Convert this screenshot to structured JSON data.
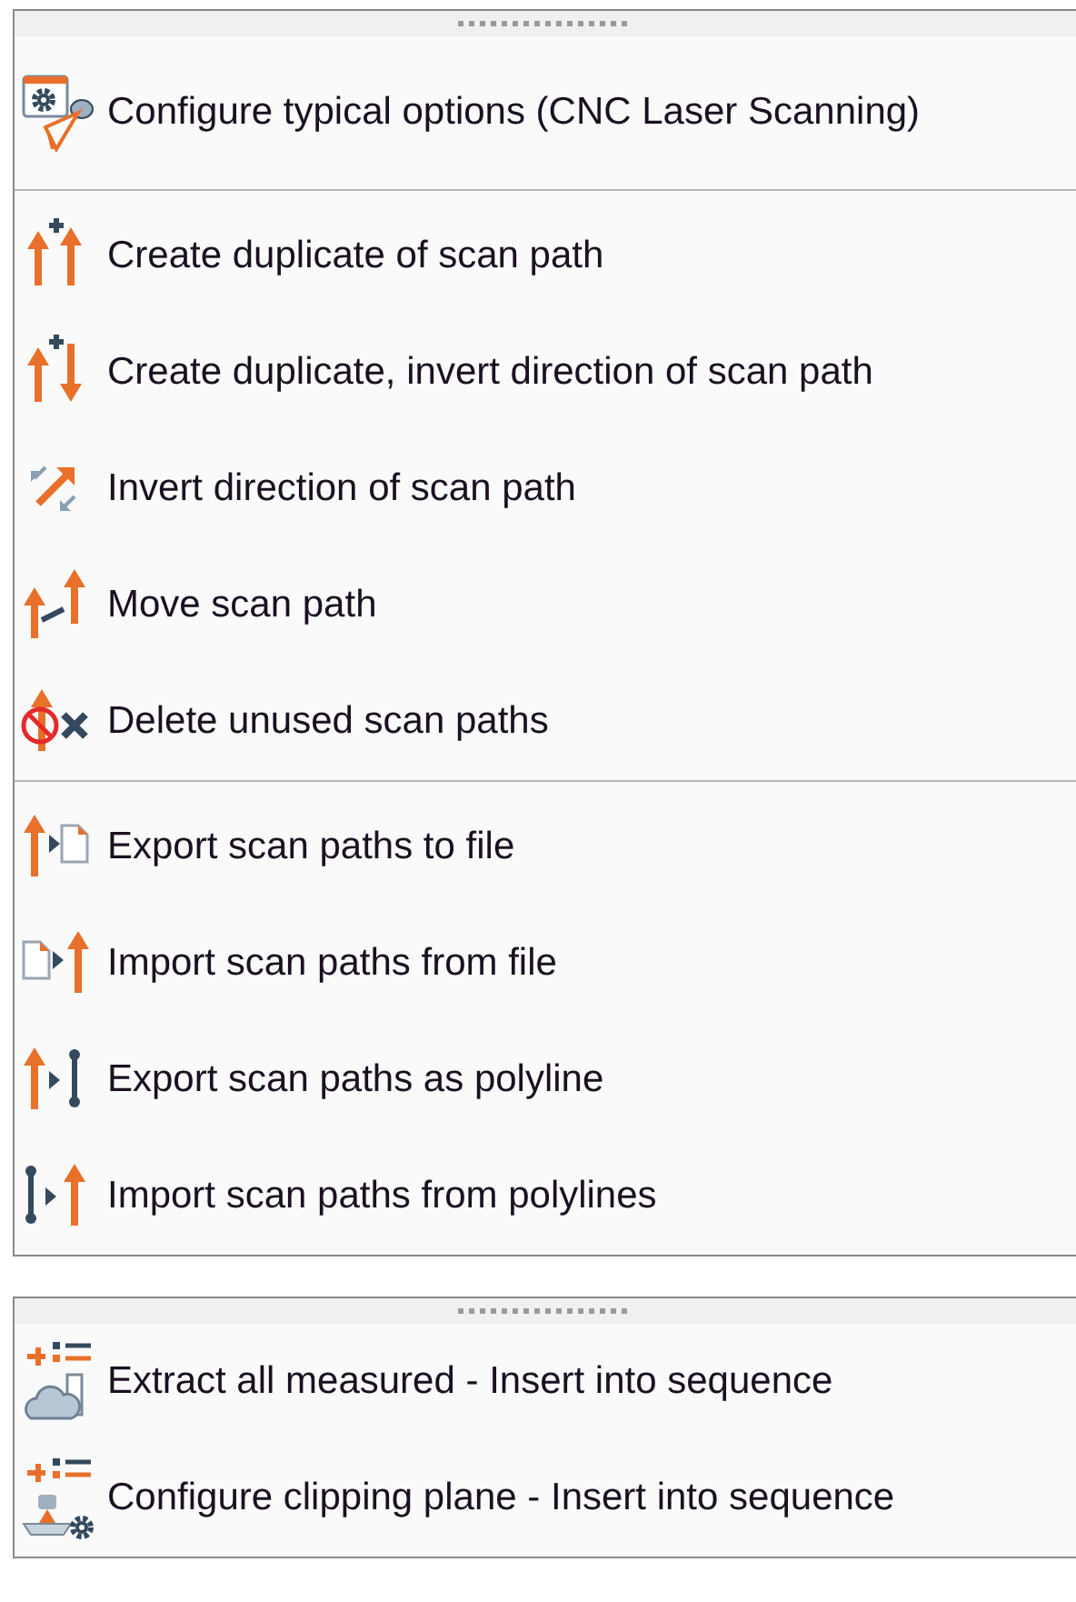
{
  "panels": [
    {
      "groups": [
        {
          "items": [
            {
              "label": "Configure typical options (CNC Laser Scanning)"
            }
          ]
        },
        {
          "items": [
            {
              "label": "Create duplicate of scan path"
            },
            {
              "label": "Create duplicate, invert direction of scan path"
            },
            {
              "label": "Invert direction of scan path"
            },
            {
              "label": "Move scan path"
            },
            {
              "label": "Delete unused scan paths"
            }
          ]
        },
        {
          "items": [
            {
              "label": "Export scan paths to file"
            },
            {
              "label": "Import scan paths from file"
            },
            {
              "label": "Export scan paths as polyline"
            },
            {
              "label": "Import scan paths from polylines"
            }
          ]
        }
      ]
    },
    {
      "groups": [
        {
          "items": [
            {
              "label": "Extract all measured - Insert into sequence"
            },
            {
              "label": "Configure clipping plane - Insert into sequence"
            }
          ]
        }
      ]
    }
  ]
}
